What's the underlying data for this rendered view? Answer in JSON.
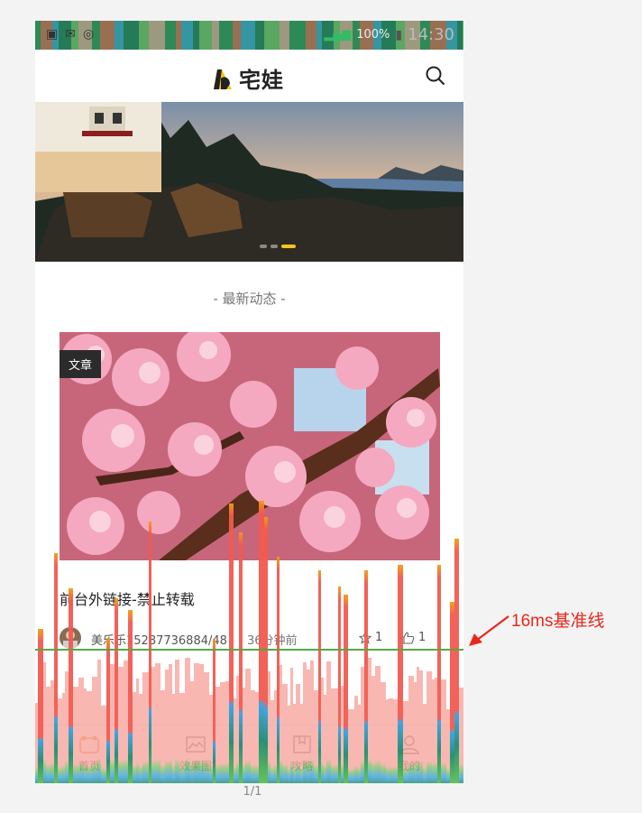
{
  "status_bar": {
    "battery_percent": "100%",
    "time": "14:30"
  },
  "header": {
    "logo_text": "宅娃",
    "search_icon": "search-icon"
  },
  "banner": {
    "slide_count": 3,
    "active_slide": 3
  },
  "section": {
    "title": "- 最新动态 -"
  },
  "card": {
    "tag": "文章",
    "title": "前台外链接-禁止转载",
    "author": "美乐乐15287736884/48",
    "time": "36分钟前",
    "favorites": "1",
    "likes": "1"
  },
  "tabbar": {
    "items": [
      {
        "label": "首页",
        "icon": "home-icon"
      },
      {
        "label": "效果图",
        "icon": "image-icon"
      },
      {
        "label": "攻略",
        "icon": "bookmark-icon"
      },
      {
        "label": "我的",
        "icon": "user-icon"
      }
    ]
  },
  "annotation": {
    "label": "16ms基准线"
  },
  "pager": {
    "text": "1/1"
  },
  "colors": {
    "accent_yellow": "#f5c518",
    "profiler_red": "#f25a4f",
    "profiler_light_red": "#f7a59e",
    "baseline_green": "#58a845",
    "annotation_red": "#e8271c"
  }
}
